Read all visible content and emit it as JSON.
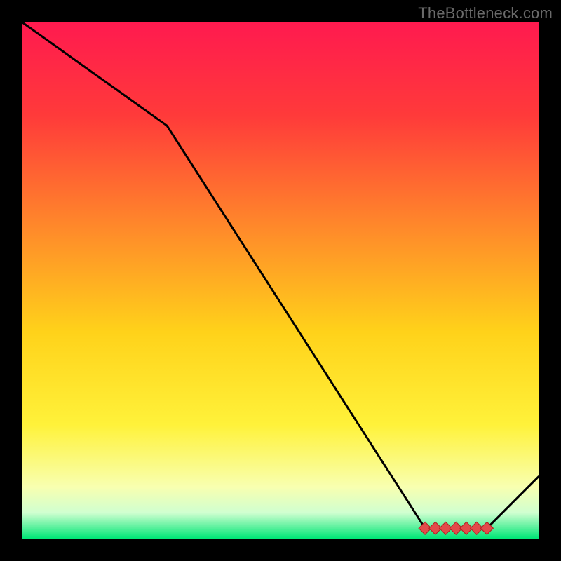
{
  "attribution": "TheBottleneck.com",
  "chart_data": {
    "type": "line",
    "title": "",
    "xlabel": "",
    "ylabel": "",
    "xlim": [
      0,
      100
    ],
    "ylim": [
      0,
      100
    ],
    "x": [
      0,
      28,
      78,
      90,
      100
    ],
    "values": [
      100,
      80,
      2,
      2,
      12
    ],
    "markers": {
      "shape": "diamond",
      "color": "#e24a4a",
      "x": [
        78,
        80,
        82,
        84,
        86,
        88,
        90
      ],
      "y": [
        2,
        2,
        2,
        2,
        2,
        2,
        2
      ]
    },
    "background_gradient_stops": [
      {
        "offset": 0.0,
        "color": "#ff1a4f"
      },
      {
        "offset": 0.18,
        "color": "#ff3a3a"
      },
      {
        "offset": 0.4,
        "color": "#ff8a2a"
      },
      {
        "offset": 0.6,
        "color": "#ffd21a"
      },
      {
        "offset": 0.78,
        "color": "#fff23a"
      },
      {
        "offset": 0.9,
        "color": "#f8ffb0"
      },
      {
        "offset": 0.95,
        "color": "#d0ffd0"
      },
      {
        "offset": 1.0,
        "color": "#00e676"
      }
    ]
  }
}
